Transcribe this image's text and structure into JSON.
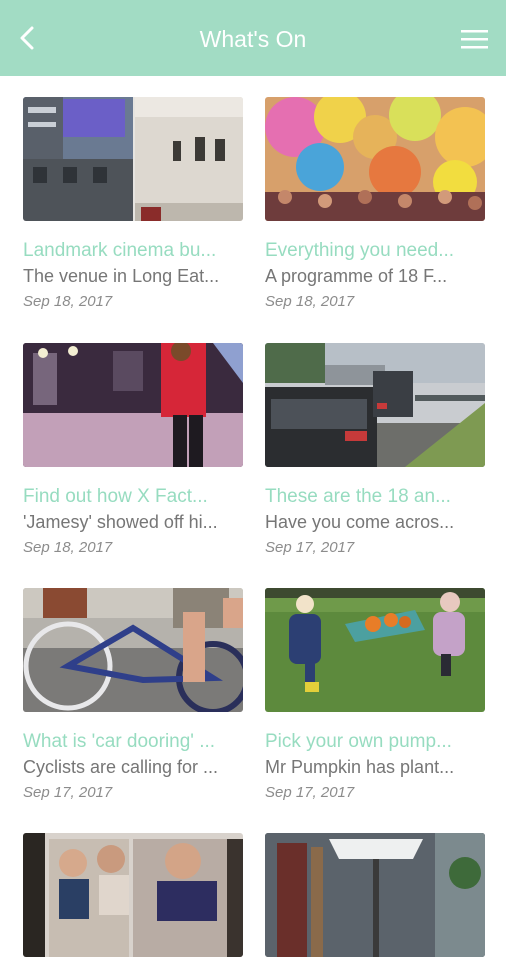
{
  "header": {
    "title": "What's On",
    "back_icon": "chevron-left-icon",
    "menu_icon": "hamburger-menu-icon",
    "background_color": "#a2dcc4"
  },
  "articles": [
    {
      "title": "Landmark cinema bu...",
      "summary": "The venue in Long Eat...",
      "date": "Sep 18, 2017"
    },
    {
      "title": "Everything you need...",
      "summary": "A programme of 18 F...",
      "date": "Sep 18, 2017"
    },
    {
      "title": "Find out how X Fact...",
      "summary": "'Jamesy' showed off hi...",
      "date": "Sep 18, 2017"
    },
    {
      "title": "These are the 18 an...",
      "summary": "Have you come acros...",
      "date": "Sep 17, 2017"
    },
    {
      "title": "What is 'car dooring' ...",
      "summary": "Cyclists are calling for ...",
      "date": "Sep 17, 2017"
    },
    {
      "title": "Pick your own pump...",
      "summary": "Mr Pumpkin has plant...",
      "date": "Sep 17, 2017"
    },
    {
      "title": "",
      "summary": "",
      "date": ""
    },
    {
      "title": "",
      "summary": "",
      "date": ""
    }
  ]
}
